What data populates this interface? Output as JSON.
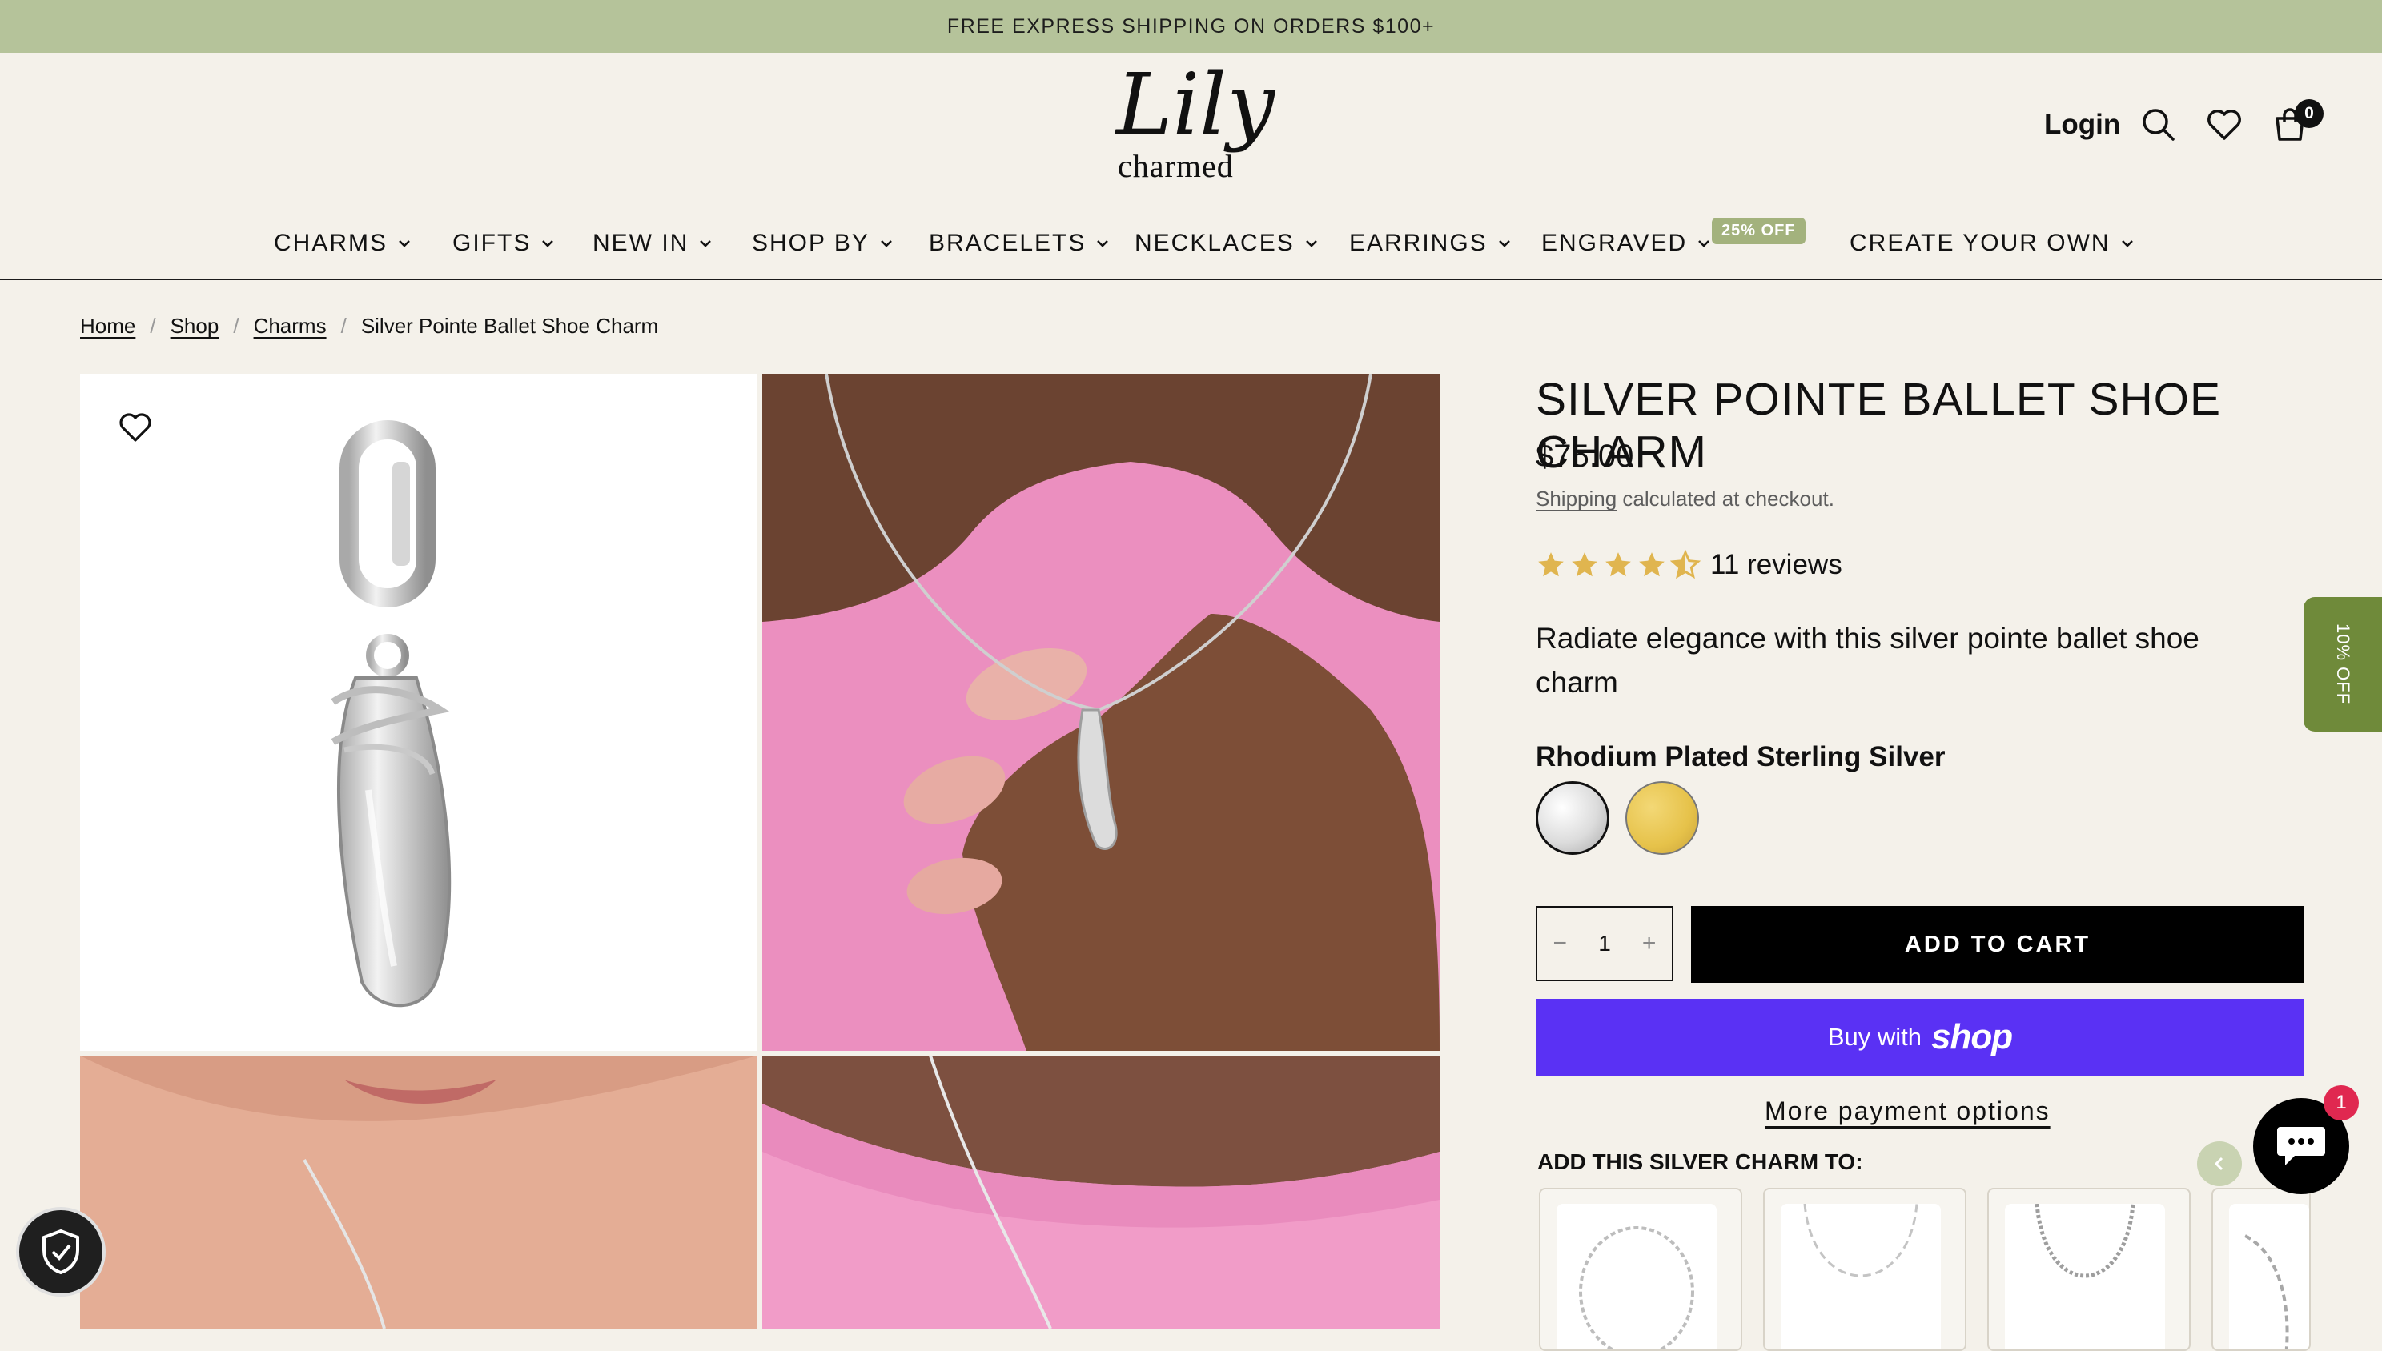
{
  "announcement": "FREE EXPRESS SHIPPING ON ORDERS $100+",
  "logo": {
    "script": "Lily",
    "sub": "charmed"
  },
  "header": {
    "login": "Login",
    "cart_count": "0"
  },
  "nav": [
    {
      "label": "CHARMS"
    },
    {
      "label": "GIFTS"
    },
    {
      "label": "NEW IN"
    },
    {
      "label": "SHOP BY"
    },
    {
      "label": "BRACELETS"
    },
    {
      "label": "NECKLACES"
    },
    {
      "label": "EARRINGS"
    },
    {
      "label": "ENGRAVED",
      "badge": "25% OFF"
    },
    {
      "label": "CREATE YOUR OWN"
    }
  ],
  "breadcrumb": [
    "Home",
    "Shop",
    "Charms",
    "Silver Pointe Ballet Shoe Charm"
  ],
  "product": {
    "title": "SILVER POINTE BALLET SHOE CHARM",
    "price": "$75.00",
    "shipping_link": "Shipping",
    "shipping_rest": " calculated at checkout.",
    "rating": 4.5,
    "reviews": "11 reviews",
    "description": "Radiate elegance with this silver pointe ballet shoe charm",
    "variant_label": "Rhodium Plated Sterling Silver",
    "quantity": "1",
    "add_to_cart": "ADD TO CART",
    "buy_with": "Buy with",
    "shop_brand": "shop",
    "more_payment": "More payment options",
    "add_to_heading": "ADD THIS SILVER CHARM TO:"
  },
  "side_tab": "10% OFF",
  "chat_badge": "1",
  "colors": {
    "announce_bg": "#b5c39a",
    "page_bg": "#f4f1ea",
    "shop_pay": "#5a31f4",
    "star": "#e0b54f",
    "side_tab": "#6f8a3a",
    "pink": "#eb8fbf"
  }
}
